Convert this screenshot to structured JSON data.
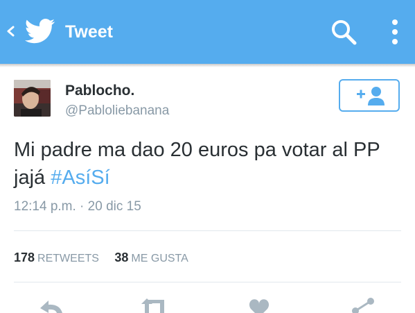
{
  "topbar": {
    "title": "Tweet",
    "icons": [
      "back-chevron-icon",
      "twitter-bird-icon",
      "search-icon",
      "overflow-menu-icon"
    ],
    "color": "#55acee"
  },
  "tweet": {
    "display_name": "Pablocho.",
    "handle": "@Pabloliebanana",
    "text": "Mi padre ma dao 20 euros pa votar al PP jajá",
    "hashtag": "#AsíSí",
    "timestamp": "12:14 p.m. · 20 dic 15",
    "follow_icon": "add-user-icon"
  },
  "stats": {
    "retweets_count": "178",
    "retweets_label": "RETWEETS",
    "likes_count": "38",
    "likes_label": "ME GUSTA"
  },
  "actions": [
    "reply-icon",
    "retweet-icon",
    "like-icon",
    "share-icon"
  ],
  "colors": {
    "accent": "#55acee",
    "text": "#292f33",
    "muted": "#8899a6",
    "divider": "#e1e8ed"
  }
}
